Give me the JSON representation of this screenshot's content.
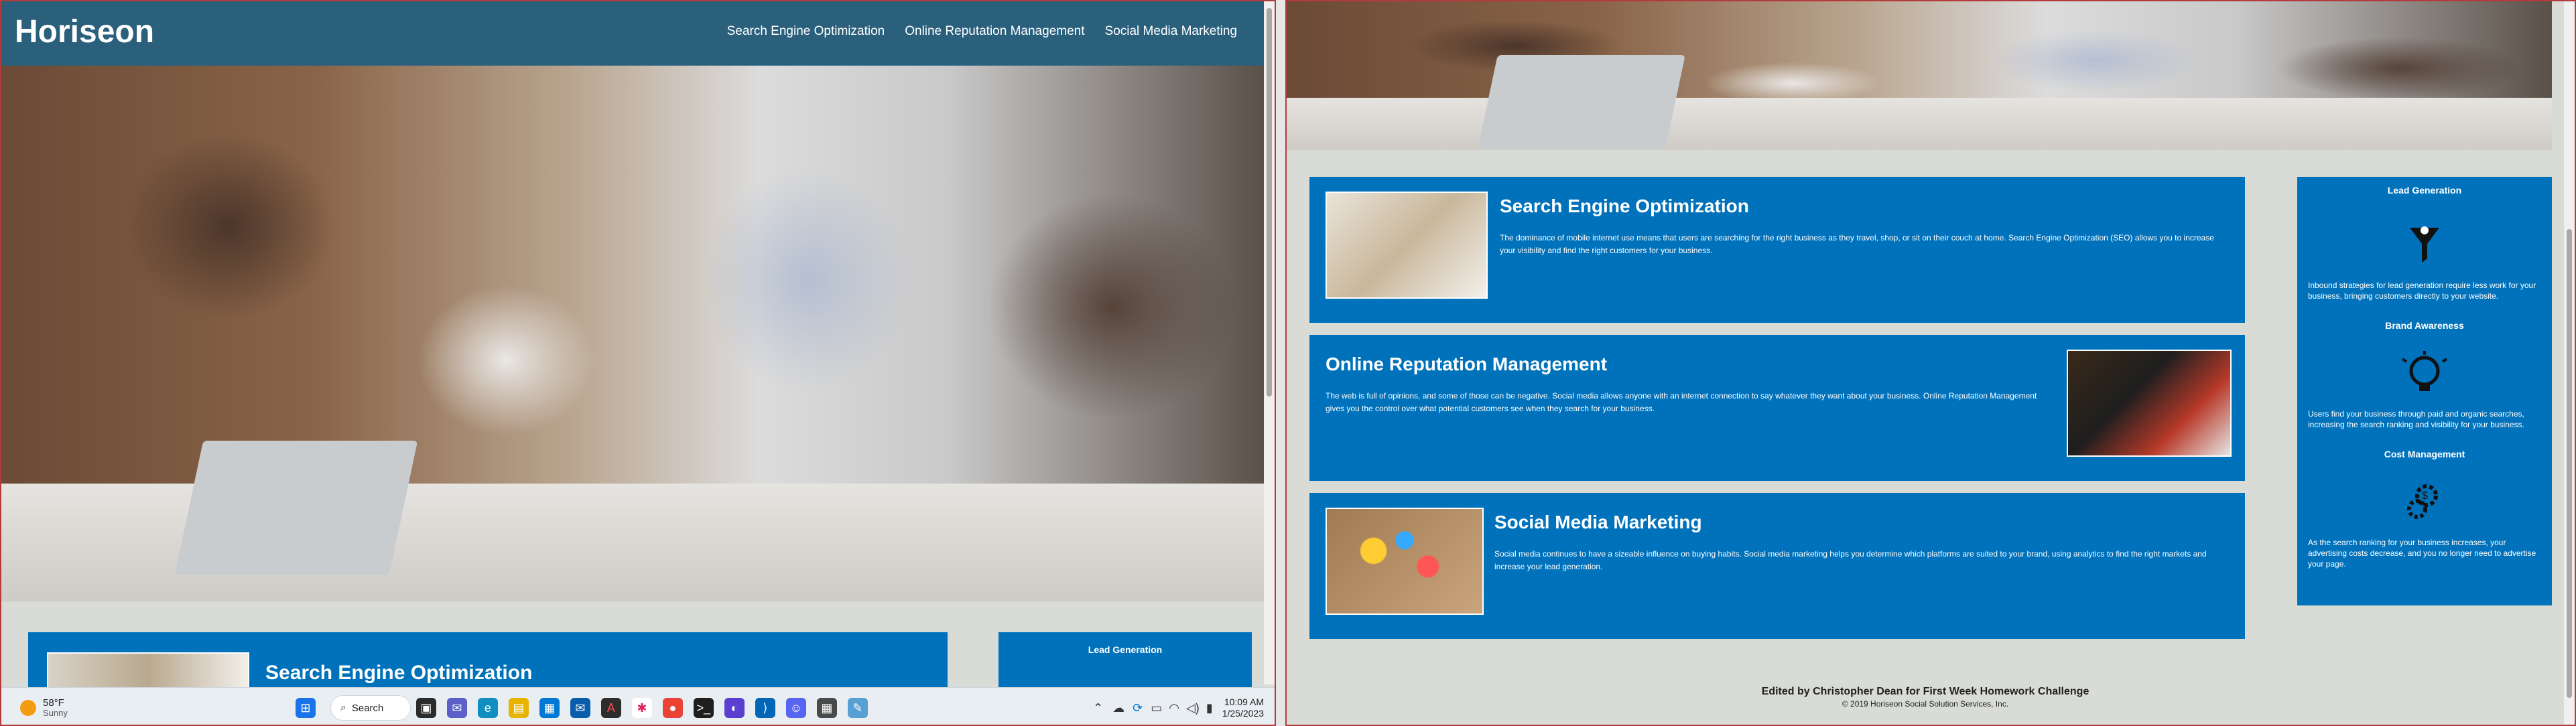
{
  "site": {
    "logo": "Horiseon",
    "nav": [
      "Search Engine Optimization",
      "Online Reputation Management",
      "Social Media Marketing"
    ]
  },
  "content": [
    {
      "title": "Search Engine Optimization",
      "text": "The dominance of mobile internet use means that users are searching for the right business as they travel, shop, or sit on their couch at home. Search Engine Optimization (SEO) allows you to increase your visibility and find the right customers for your business."
    },
    {
      "title": "Online Reputation Management",
      "text": "The web is full of opinions, and some of those can be negative. Social media allows anyone with an internet connection to say whatever they want about your business. Online Reputation Management gives you the control over what potential customers see when they search for your business."
    },
    {
      "title": "Social Media Marketing",
      "text": "Social media continues to have a sizeable influence on buying habits. Social media marketing helps you determine which platforms are suited to your brand, using analytics to find the right markets and increase your lead generation."
    }
  ],
  "benefits": [
    {
      "title": "Lead Generation",
      "icon": "funnel-icon",
      "text": "Inbound strategies for lead generation require less work for your business, bringing customers directly to your website."
    },
    {
      "title": "Brand Awareness",
      "icon": "lightbulb-icon",
      "text": "Users find your business through paid and organic searches, increasing the search ranking and visibility for your business."
    },
    {
      "title": "Cost Management",
      "icon": "gears-dollar-icon",
      "text": "As the search ranking for your business increases, your advertising costs decrease, and you no longer need to advertise your page."
    }
  ],
  "footer": {
    "credit": "Edited by Christopher Dean for First Week Homework Challenge",
    "copyright": "© 2019 Horiseon Social Solution Services, Inc."
  },
  "taskbar": {
    "weather_temp": "58°F",
    "weather_text": "Sunny",
    "search": "Search",
    "time": "10:09 AM",
    "date": "1/25/2023"
  }
}
